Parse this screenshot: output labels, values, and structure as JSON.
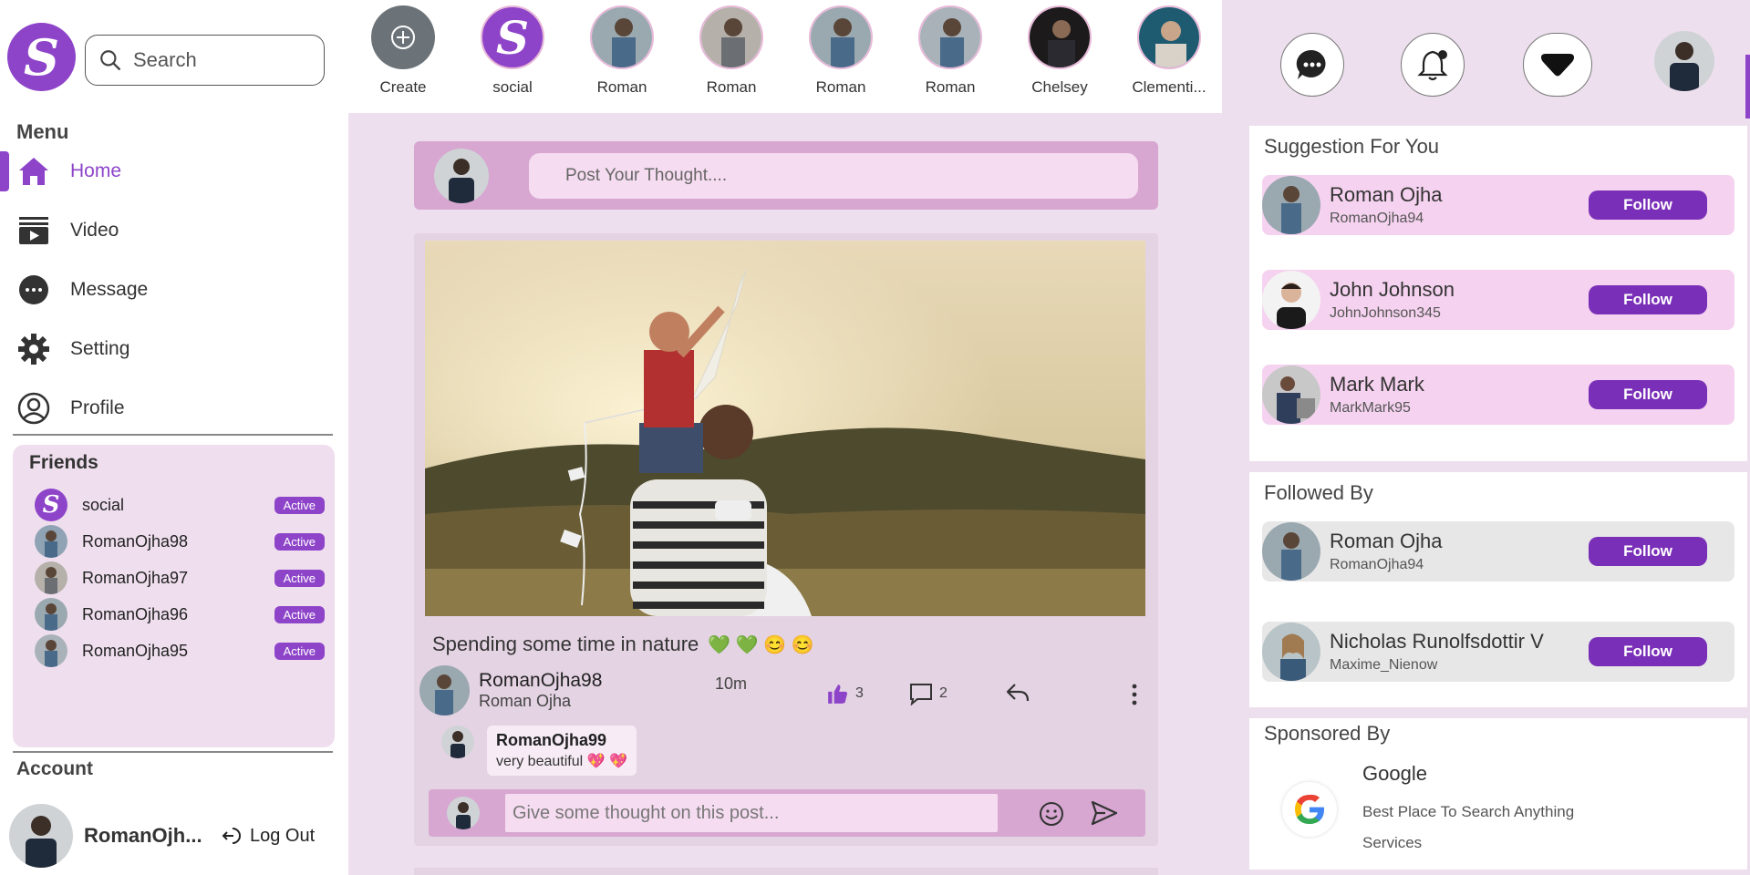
{
  "app": {
    "logo_letter": "S",
    "brand_color": "#8e44c9"
  },
  "search": {
    "placeholder": "Search"
  },
  "menu": {
    "title": "Menu",
    "items": [
      {
        "label": "Home",
        "icon": "home-icon",
        "active": true
      },
      {
        "label": "Video",
        "icon": "video-icon"
      },
      {
        "label": "Message",
        "icon": "message-icon"
      },
      {
        "label": "Setting",
        "icon": "gear-icon"
      },
      {
        "label": "Profile",
        "icon": "user-icon"
      }
    ]
  },
  "friends": {
    "title": "Friends",
    "list": [
      {
        "name": "social",
        "status": "Active"
      },
      {
        "name": "RomanOjha98",
        "status": "Active"
      },
      {
        "name": "RomanOjha97",
        "status": "Active"
      },
      {
        "name": "RomanOjha96",
        "status": "Active"
      },
      {
        "name": "RomanOjha95",
        "status": "Active"
      }
    ]
  },
  "account": {
    "title": "Account",
    "name": "RomanOjh...",
    "logout_label": "Log Out"
  },
  "stories": [
    {
      "label": "Create"
    },
    {
      "label": "social"
    },
    {
      "label": "Roman"
    },
    {
      "label": "Roman"
    },
    {
      "label": "Roman"
    },
    {
      "label": "Roman"
    },
    {
      "label": "Chelsey"
    },
    {
      "label": "Clementi..."
    }
  ],
  "compose": {
    "placeholder": "Post Your Thought...."
  },
  "post": {
    "caption": "Spending some time in nature",
    "caption_emojis": "💚 💚 😊 😊",
    "username": "RomanOjha98",
    "fullname": "Roman Ojha",
    "time": "10m",
    "likes": "3",
    "comments": "2",
    "comment": {
      "username": "RomanOjha99",
      "text": "very beautiful 💖 💖"
    },
    "reply_placeholder": "Give some thought on this post..."
  },
  "suggestions": {
    "title": "Suggestion For You",
    "list": [
      {
        "name": "Roman Ojha",
        "username": "RomanOjha94",
        "button": "Follow"
      },
      {
        "name": "John Johnson",
        "username": "JohnJohnson345",
        "button": "Follow"
      },
      {
        "name": "Mark Mark",
        "username": "MarkMark95",
        "button": "Follow"
      }
    ]
  },
  "followed_by": {
    "title": "Followed By",
    "list": [
      {
        "name": "Roman Ojha",
        "username": "RomanOjha94",
        "button": "Follow"
      },
      {
        "name": "Nicholas Runolfsdottir V",
        "username": "Maxime_Nienow",
        "button": "Follow"
      }
    ]
  },
  "sponsored": {
    "title": "Sponsored By",
    "name": "Google",
    "description": "Best Place To Search Anything Services"
  }
}
